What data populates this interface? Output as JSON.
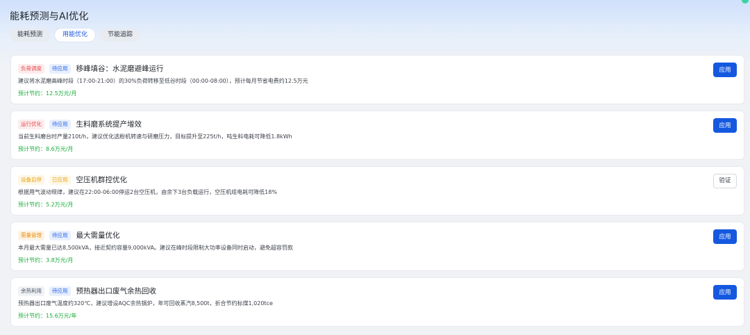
{
  "page": {
    "title": "能耗预测与AI优化"
  },
  "tabs": [
    {
      "label": "能耗预测",
      "active": false
    },
    {
      "label": "用能优化",
      "active": true
    },
    {
      "label": "节能追踪",
      "active": false
    }
  ],
  "cards": [
    {
      "category": "负荷调度",
      "category_color": "red",
      "status": "待应用",
      "status_color": "blue",
      "title": "移峰填谷：水泥磨避峰运行",
      "description": "建议将水泥磨高峰时段（17:00-21:00）的30%负荷转移至低谷时段（00:00-08:00），预计每月节省电费约12.5万元",
      "saving": "预计节约：12.5万元/月",
      "action": "应用",
      "action_type": "primary"
    },
    {
      "category": "运行优化",
      "category_color": "red",
      "status": "待应用",
      "status_color": "blue",
      "title": "生料磨系统提产增效",
      "description": "当前生料磨台时产量210t/h，建议优化选粉机转速与研磨压力，目标提升至225t/h，吨生料电耗可降低1.8kWh",
      "saving": "预计节约：8.6万元/月",
      "action": "应用",
      "action_type": "primary"
    },
    {
      "category": "设备启停",
      "category_color": "yellow",
      "status": "已应用",
      "status_color": "yellow",
      "title": "空压机群控优化",
      "description": "根据用气波动规律，建议在22:00-06:00停运2台空压机，由余下3台负载运行，空压机组电耗可降低18%",
      "saving": "预计节约：5.2万元/月",
      "action": "验证",
      "action_type": "secondary"
    },
    {
      "category": "需量管理",
      "category_color": "orange",
      "status": "待应用",
      "status_color": "blue",
      "title": "最大需量优化",
      "description": "本月最大需量已达8,500kVA，接近契约容量9,000kVA。建议在峰时段限制大功率设备同时启动，避免超容罚款",
      "saving": "预计节约：3.8万元/月",
      "action": "应用",
      "action_type": "primary"
    },
    {
      "category": "余热利用",
      "category_color": "gray",
      "status": "待应用",
      "status_color": "blue",
      "title": "预热器出口废气余热回收",
      "description": "预热器出口废气温度约320℃，建议增设AQC余热锅炉，年可回收蒸汽8,500t，折合节约标煤1,020tce",
      "saving": "预计节约：15.6万元/年",
      "action": "应用",
      "action_type": "primary"
    }
  ]
}
